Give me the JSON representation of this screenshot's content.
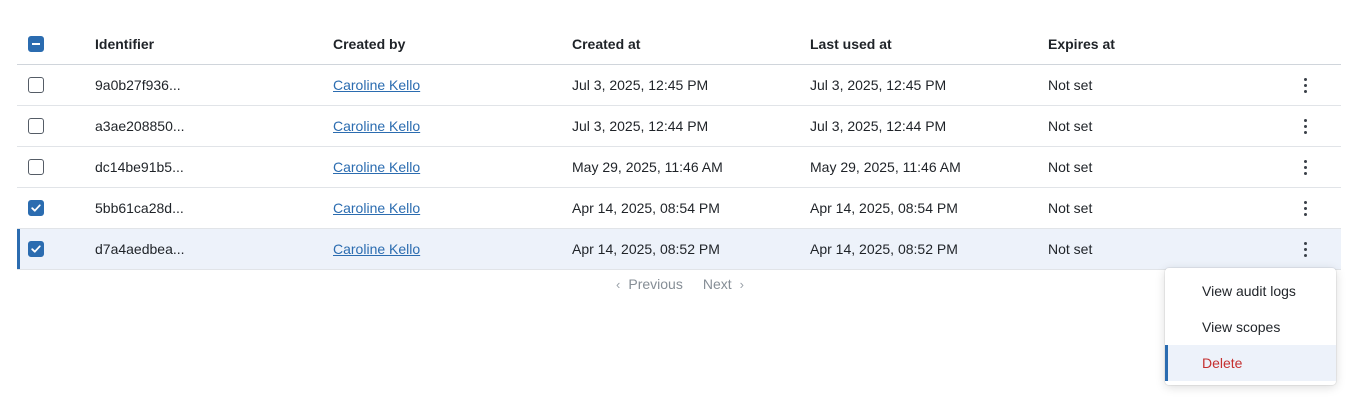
{
  "table": {
    "headers": {
      "identifier": "Identifier",
      "created_by": "Created by",
      "created_at": "Created at",
      "last_used_at": "Last used at",
      "expires_at": "Expires at"
    },
    "select_all_state": "indeterminate",
    "rows": [
      {
        "checked": false,
        "identifier": "9a0b27f936...",
        "created_by": "Caroline Kello",
        "created_at": "Jul 3, 2025, 12:45 PM",
        "last_used_at": "Jul 3, 2025, 12:45 PM",
        "expires_at": "Not set"
      },
      {
        "checked": false,
        "identifier": "a3ae208850...",
        "created_by": "Caroline Kello",
        "created_at": "Jul 3, 2025, 12:44 PM",
        "last_used_at": "Jul 3, 2025, 12:44 PM",
        "expires_at": "Not set"
      },
      {
        "checked": false,
        "identifier": "dc14be91b5...",
        "created_by": "Caroline Kello",
        "created_at": "May 29, 2025, 11:46 AM",
        "last_used_at": "May 29, 2025, 11:46 AM",
        "expires_at": "Not set"
      },
      {
        "checked": true,
        "identifier": "5bb61ca28d...",
        "created_by": "Caroline Kello",
        "created_at": "Apr 14, 2025, 08:54 PM",
        "last_used_at": "Apr 14, 2025, 08:54 PM",
        "expires_at": "Not set"
      },
      {
        "checked": true,
        "identifier": "d7a4aedbea...",
        "created_by": "Caroline Kello",
        "created_at": "Apr 14, 2025, 08:52 PM",
        "last_used_at": "Apr 14, 2025, 08:52 PM",
        "expires_at": "Not set"
      }
    ]
  },
  "pagination": {
    "previous_label": "Previous",
    "next_label": "Next"
  },
  "context_menu": {
    "items": [
      {
        "label": "View audit logs"
      },
      {
        "label": "View scopes"
      },
      {
        "label": "Delete"
      }
    ]
  },
  "colors": {
    "accent": "#2b6cb0",
    "danger": "#c53030",
    "selected_row_bg": "#edf2fa"
  }
}
